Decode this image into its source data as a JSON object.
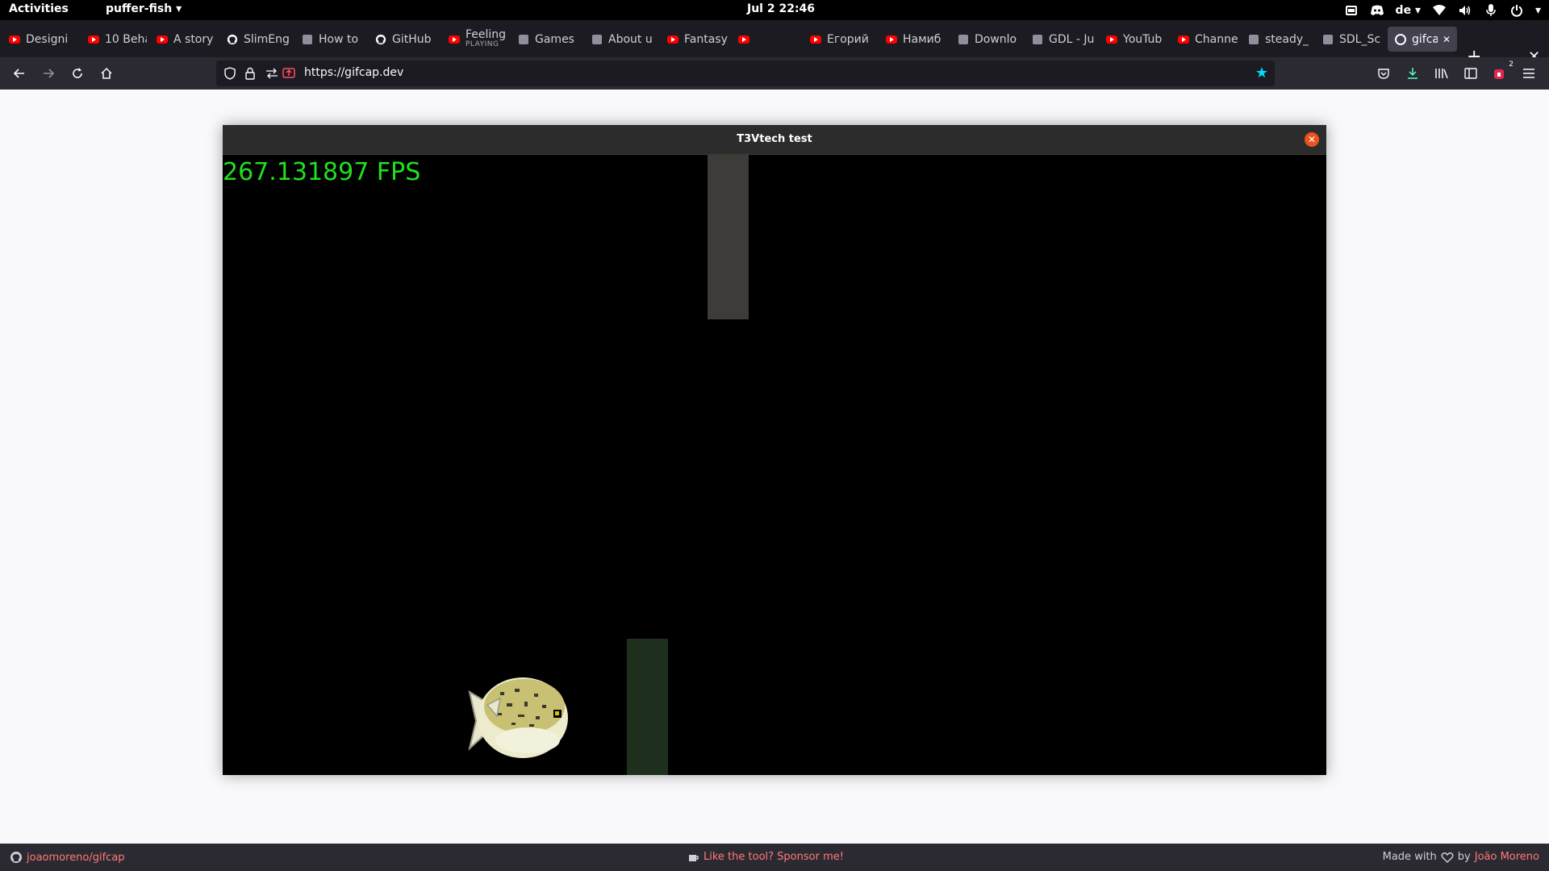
{
  "topbar": {
    "activities": "Activities",
    "app_menu": "puffer-fish ▾",
    "clock": "Jul 2  22:46",
    "keyboard_layout": "de ▾"
  },
  "tabs": [
    {
      "label": "Designi",
      "icon": "youtube-icon"
    },
    {
      "label": "10 Beha",
      "icon": "youtube-icon"
    },
    {
      "label": "A story",
      "icon": "youtube-icon"
    },
    {
      "label": "SlimEng",
      "icon": "github-icon"
    },
    {
      "label": "How to",
      "icon": "site-icon"
    },
    {
      "label": "GitHub",
      "icon": "github-icon"
    },
    {
      "label": "Feeling",
      "sub": "PLAYING",
      "icon": "youtube-icon"
    },
    {
      "label": "Games",
      "icon": "site-icon"
    },
    {
      "label": "About u",
      "icon": "site-icon"
    },
    {
      "label": "Fantasy",
      "icon": "youtube-icon"
    },
    {
      "label": "",
      "icon": "youtube-icon"
    },
    {
      "label": "Егорий",
      "icon": "youtube-icon"
    },
    {
      "label": "Намиб",
      "icon": "youtube-icon"
    },
    {
      "label": "Downlo",
      "icon": "site-icon"
    },
    {
      "label": "GDL - Ju",
      "icon": "site-icon"
    },
    {
      "label": "YouTub",
      "icon": "youtube-icon"
    },
    {
      "label": "Channe",
      "icon": "youtube-icon"
    },
    {
      "label": "steady_",
      "icon": "site-icon"
    },
    {
      "label": "SDL_Sc",
      "icon": "site-icon"
    },
    {
      "label": "gifcap",
      "icon": "gifcap-icon",
      "active": true
    }
  ],
  "navbar": {
    "url": "https://gifcap.dev",
    "extension_badge": "2"
  },
  "app_window": {
    "title": "T3Vtech test",
    "fps_text": "267.131897 FPS"
  },
  "footer": {
    "repo": "joaomoreno/gifcap",
    "sponsor": "Like the tool? Sponsor me!",
    "made_with": "Made with",
    "by": "by",
    "author": "João Moreno"
  },
  "colors": {
    "fps_green": "#20e020",
    "pipe_top": "#3d3c39",
    "pipe_bottom": "#1e2f1e",
    "close_orange": "#e95420"
  }
}
